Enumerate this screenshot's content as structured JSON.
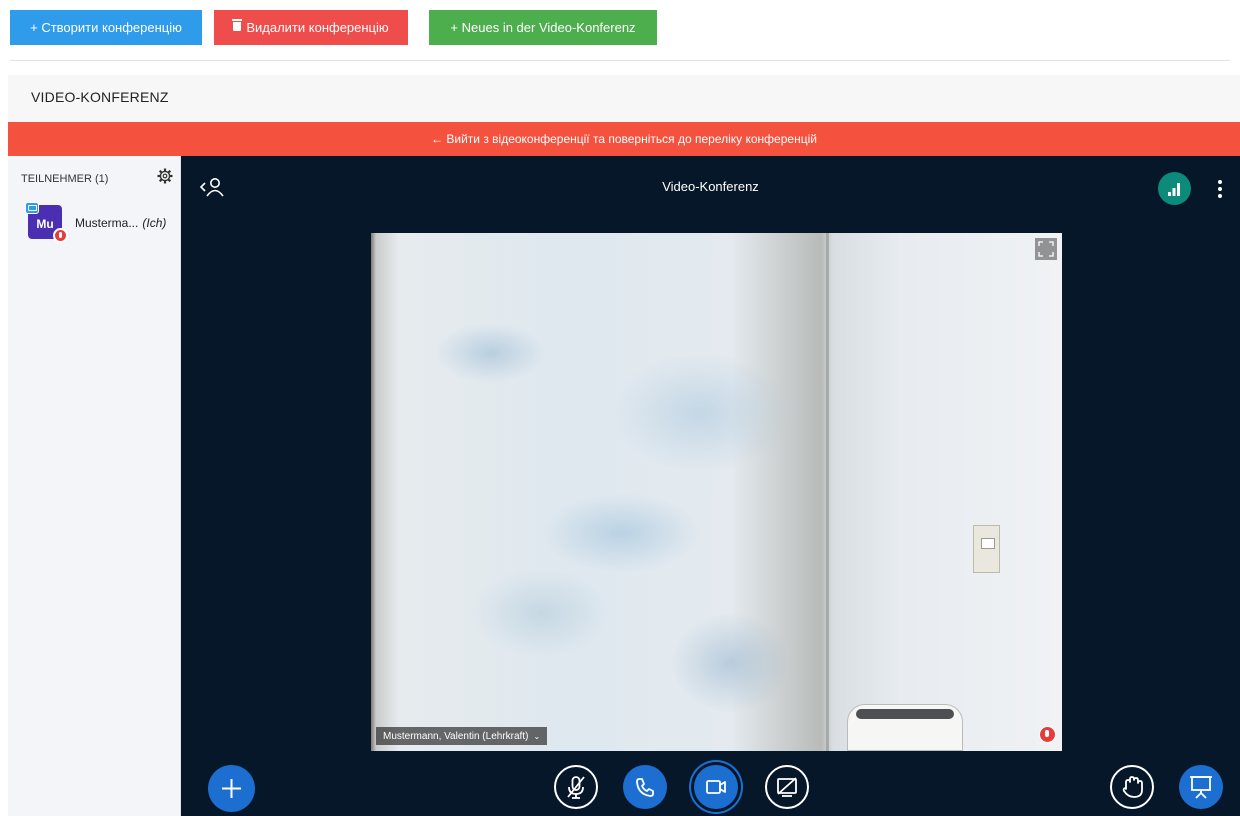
{
  "toolbar": {
    "create_label": "+ Створити конференцію",
    "delete_label": "Видалити конференцію",
    "news_label": "+ Neues in der Video-Konferenz",
    "create_color": "#2f9ceb",
    "delete_color": "#ef4c4c",
    "news_color": "#4cae4c"
  },
  "panel": {
    "title": "VIDEO-KONFERENZ"
  },
  "exit_bar": {
    "label": "← Вийти з відеоконференції та поверніться до переліку конференцій",
    "color": "#f4523f"
  },
  "sidebar": {
    "title": "TEILNEHMER (1)",
    "participants": [
      {
        "initials": "Mu",
        "name": "Musterma...",
        "you_label": "(Ich)",
        "avatar_color": "#4a2fb2",
        "presenter": true,
        "muted": true
      }
    ]
  },
  "meeting": {
    "title": "Video-Konferenz",
    "connection_icon": "signal-bars-icon",
    "video": {
      "user_label": "Mustermann, Valentin (Lehrkraft)",
      "caret": "⌄",
      "muted": true
    }
  },
  "controls": {
    "actions": "plus-icon",
    "mic": "microphone-muted-icon",
    "audio": "phone-icon",
    "video": "camera-icon",
    "screen": "screenshare-off-icon",
    "raise_hand": "hand-icon",
    "presentation": "presentation-icon"
  }
}
